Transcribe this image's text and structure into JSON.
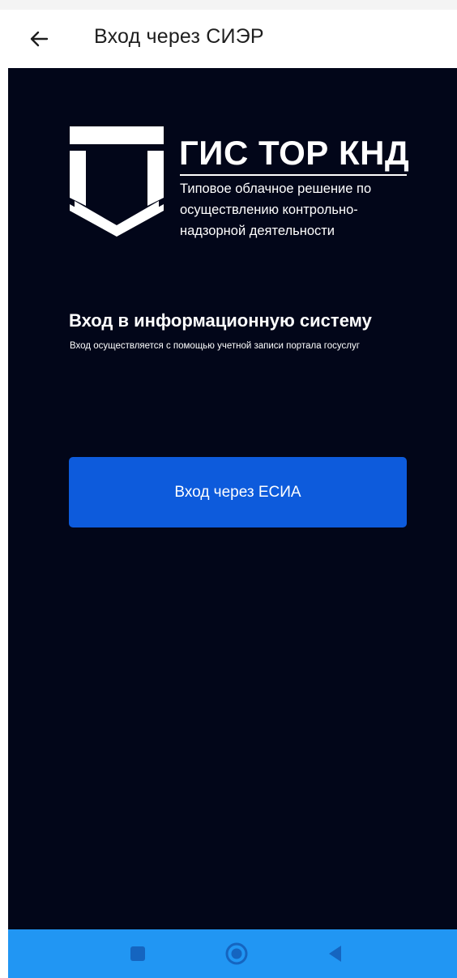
{
  "app_bar": {
    "title": "Вход через СИЭР",
    "back_icon": "arrow-left-icon"
  },
  "logo": {
    "title": "ГИС ТОР КНД",
    "subtitle": "Типовое облачное решение по осуществлению контрольно-надзорной деятельности"
  },
  "login": {
    "heading": "Вход в информационную систему",
    "description": "Вход осуществляется с помощью учетной записи портала госуслуг",
    "button_label": "Вход через ЕСИА"
  },
  "nav": {
    "recents_icon": "square-icon",
    "home_icon": "circle-icon",
    "back_icon": "triangle-back-icon"
  },
  "colors": {
    "background": "#020619",
    "accent": "#0d5bdc",
    "nav_bar": "#2196f3"
  }
}
